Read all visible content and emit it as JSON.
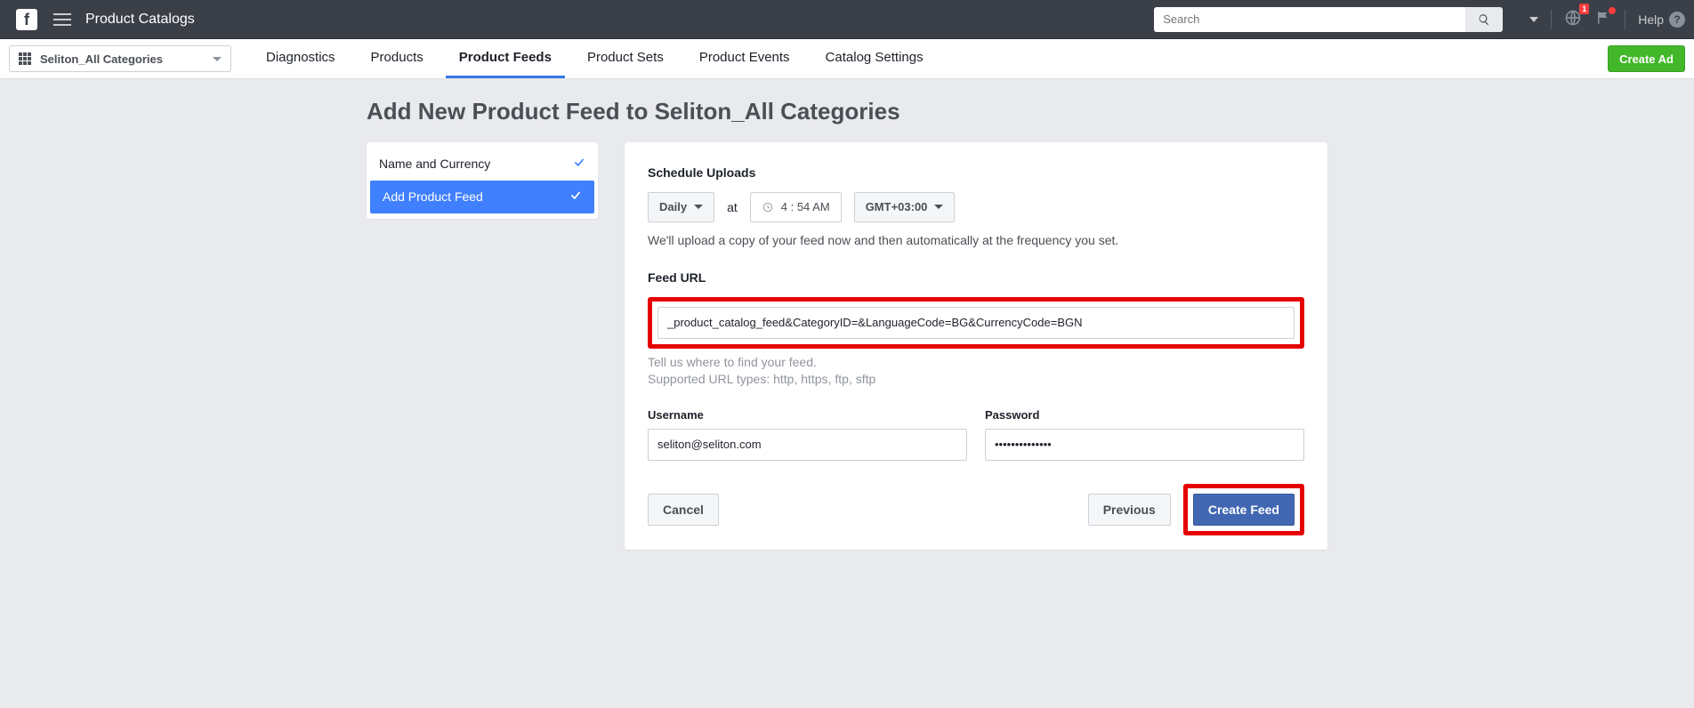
{
  "topbar": {
    "title": "Product Catalogs",
    "search_placeholder": "Search",
    "notif_badge": "1",
    "help_label": "Help"
  },
  "catalog_picker": {
    "label": "Seliton_All Categories"
  },
  "tabs": {
    "diagnostics": "Diagnostics",
    "products": "Products",
    "product_feeds": "Product Feeds",
    "product_sets": "Product Sets",
    "product_events": "Product Events",
    "catalog_settings": "Catalog Settings"
  },
  "create_ad": "Create Ad",
  "page_title": "Add New Product Feed to Seliton_All Categories",
  "steps": {
    "name_currency": "Name and Currency",
    "add_feed": "Add Product Feed"
  },
  "schedule": {
    "heading": "Schedule Uploads",
    "freq": "Daily",
    "at": "at",
    "time": "4 : 54 AM",
    "tz": "GMT+03:00",
    "hint": "We'll upload a copy of your feed now and then automatically at the frequency you set."
  },
  "feed_url": {
    "heading": "Feed URL",
    "value": "_product_catalog_feed&CategoryID=&LanguageCode=BG&CurrencyCode=BGN",
    "hint1": "Tell us where to find your feed.",
    "hint2": "Supported URL types: http, https, ftp, sftp"
  },
  "creds": {
    "username_label": "Username",
    "username_value": "seliton@seliton.com",
    "password_label": "Password",
    "password_value": "••••••••••••••"
  },
  "footer": {
    "cancel": "Cancel",
    "previous": "Previous",
    "create_feed": "Create Feed"
  }
}
